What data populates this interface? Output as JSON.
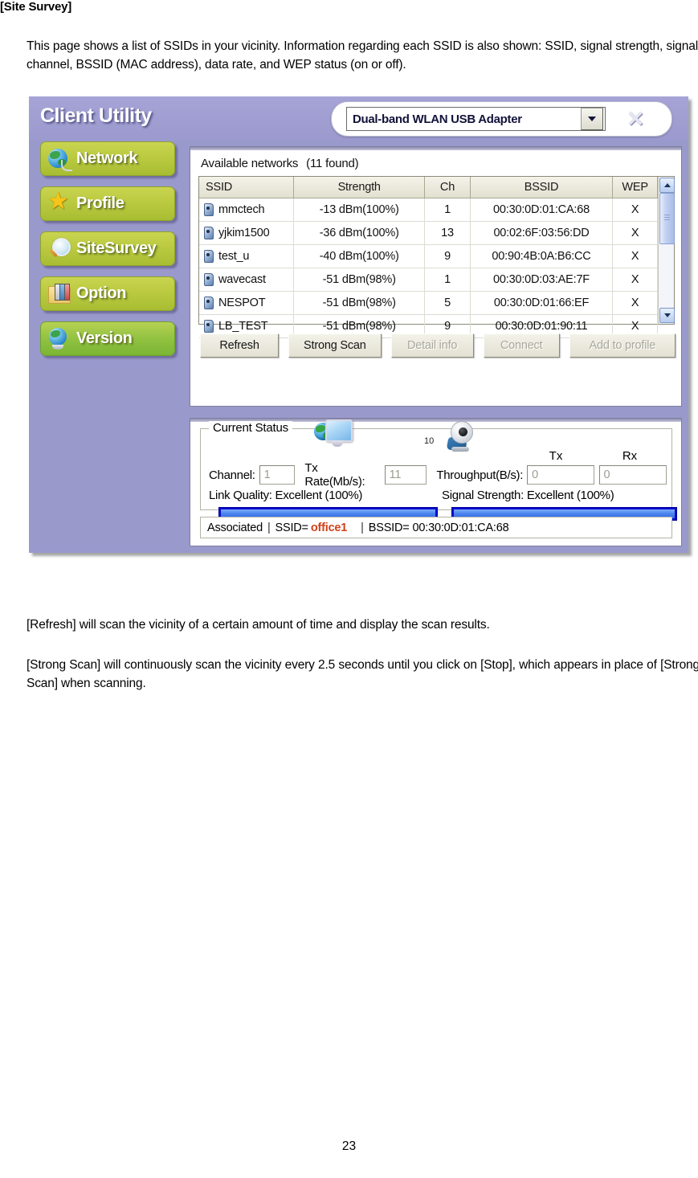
{
  "document": {
    "heading": "[Site Survey]",
    "intro_paragraph": "This page shows a list of SSIDs in your vicinity. Information regarding each SSID is also shown: SSID, signal strength, signal channel, BSSID (MAC address), data rate, and WEP status (on or off).",
    "refresh_paragraph": "[Refresh] will scan the vicinity of a certain amount of time and display the scan results.",
    "strongscan_paragraph": "[Strong Scan] will continuously scan the vicinity every 2.5 seconds until you click on [Stop], which appears in place of [Strong Scan] when scanning.",
    "page_number": "23"
  },
  "app": {
    "title": "Client Utility",
    "adapter": {
      "selected": "Dual-band WLAN USB Adapter",
      "arrow_icon": "chevron-down-icon"
    },
    "close_label": "✕",
    "colors": {
      "titlebar": "#9b99cd",
      "sidebar": "#9a99cc",
      "nav_button": "#b9c93f",
      "meter": "#0a0ad2",
      "associated_ssid": "#d2401a"
    },
    "sidebar": {
      "items": [
        {
          "label": "Network",
          "icon": "globe-network-icon"
        },
        {
          "label": "Profile",
          "icon": "star-icon"
        },
        {
          "label": "SiteSurvey",
          "icon": "magnifier-icon"
        },
        {
          "label": "Option",
          "icon": "folder-books-icon"
        },
        {
          "label": "Version",
          "icon": "globe-stand-icon"
        }
      ]
    },
    "networks_panel": {
      "label": "Available networks",
      "count_text": "(11 found)",
      "columns": [
        "SSID",
        "Strength",
        "Ch",
        "BSSID",
        "WEP"
      ],
      "rows": [
        {
          "ssid": "mmctech",
          "strength": "-13 dBm(100%)",
          "ch": "1",
          "bssid": "00:30:0D:01:CA:68",
          "wep": "X"
        },
        {
          "ssid": "yjkim1500",
          "strength": "-36 dBm(100%)",
          "ch": "13",
          "bssid": "00:02:6F:03:56:DD",
          "wep": "X"
        },
        {
          "ssid": "test_u",
          "strength": "-40 dBm(100%)",
          "ch": "9",
          "bssid": "00:90:4B:0A:B6:CC",
          "wep": "X"
        },
        {
          "ssid": "wavecast",
          "strength": "-51 dBm(98%)",
          "ch": "1",
          "bssid": "00:30:0D:03:AE:7F",
          "wep": "X"
        },
        {
          "ssid": "NESPOT",
          "strength": "-51 dBm(98%)",
          "ch": "5",
          "bssid": "00:30:0D:01:66:EF",
          "wep": "X"
        },
        {
          "ssid": "LB_TEST",
          "strength": "-51 dBm(98%)",
          "ch": "9",
          "bssid": "00:30:0D:01:90:11",
          "wep": "X"
        }
      ],
      "buttons": [
        {
          "label": "Refresh",
          "enabled": true
        },
        {
          "label": "Strong Scan",
          "enabled": true
        },
        {
          "label": "Detail info",
          "enabled": false
        },
        {
          "label": "Connect",
          "enabled": false
        },
        {
          "label": "Add to profile",
          "enabled": false
        }
      ]
    },
    "status_panel": {
      "legend": "Current Status",
      "icons": {
        "left": "globe-monitor-icon",
        "right": "access-point-icon",
        "ap_number": "10"
      },
      "channel_label": "Channel:",
      "channel_value": "1",
      "txrate_label": "Tx Rate(Mb/s):",
      "txrate_value": "11",
      "throughput_label": "Throughput(B/s):",
      "tx_label": "Tx",
      "rx_label": "Rx",
      "tx_value": "0",
      "rx_value": "0",
      "link_quality_label": "Link Quality:",
      "link_quality_value": "Excellent (100%)",
      "link_quality_percent": 100,
      "signal_strength_label": "Signal Strength:",
      "signal_strength_value": "Excellent (100%)",
      "signal_strength_percent": 100,
      "associated": {
        "state": "Associated",
        "ssid_label": "SSID=",
        "ssid_value": "office1",
        "bssid_label": "BSSID=",
        "bssid_value": "00:30:0D:01:CA:68",
        "separator": "|"
      }
    }
  }
}
